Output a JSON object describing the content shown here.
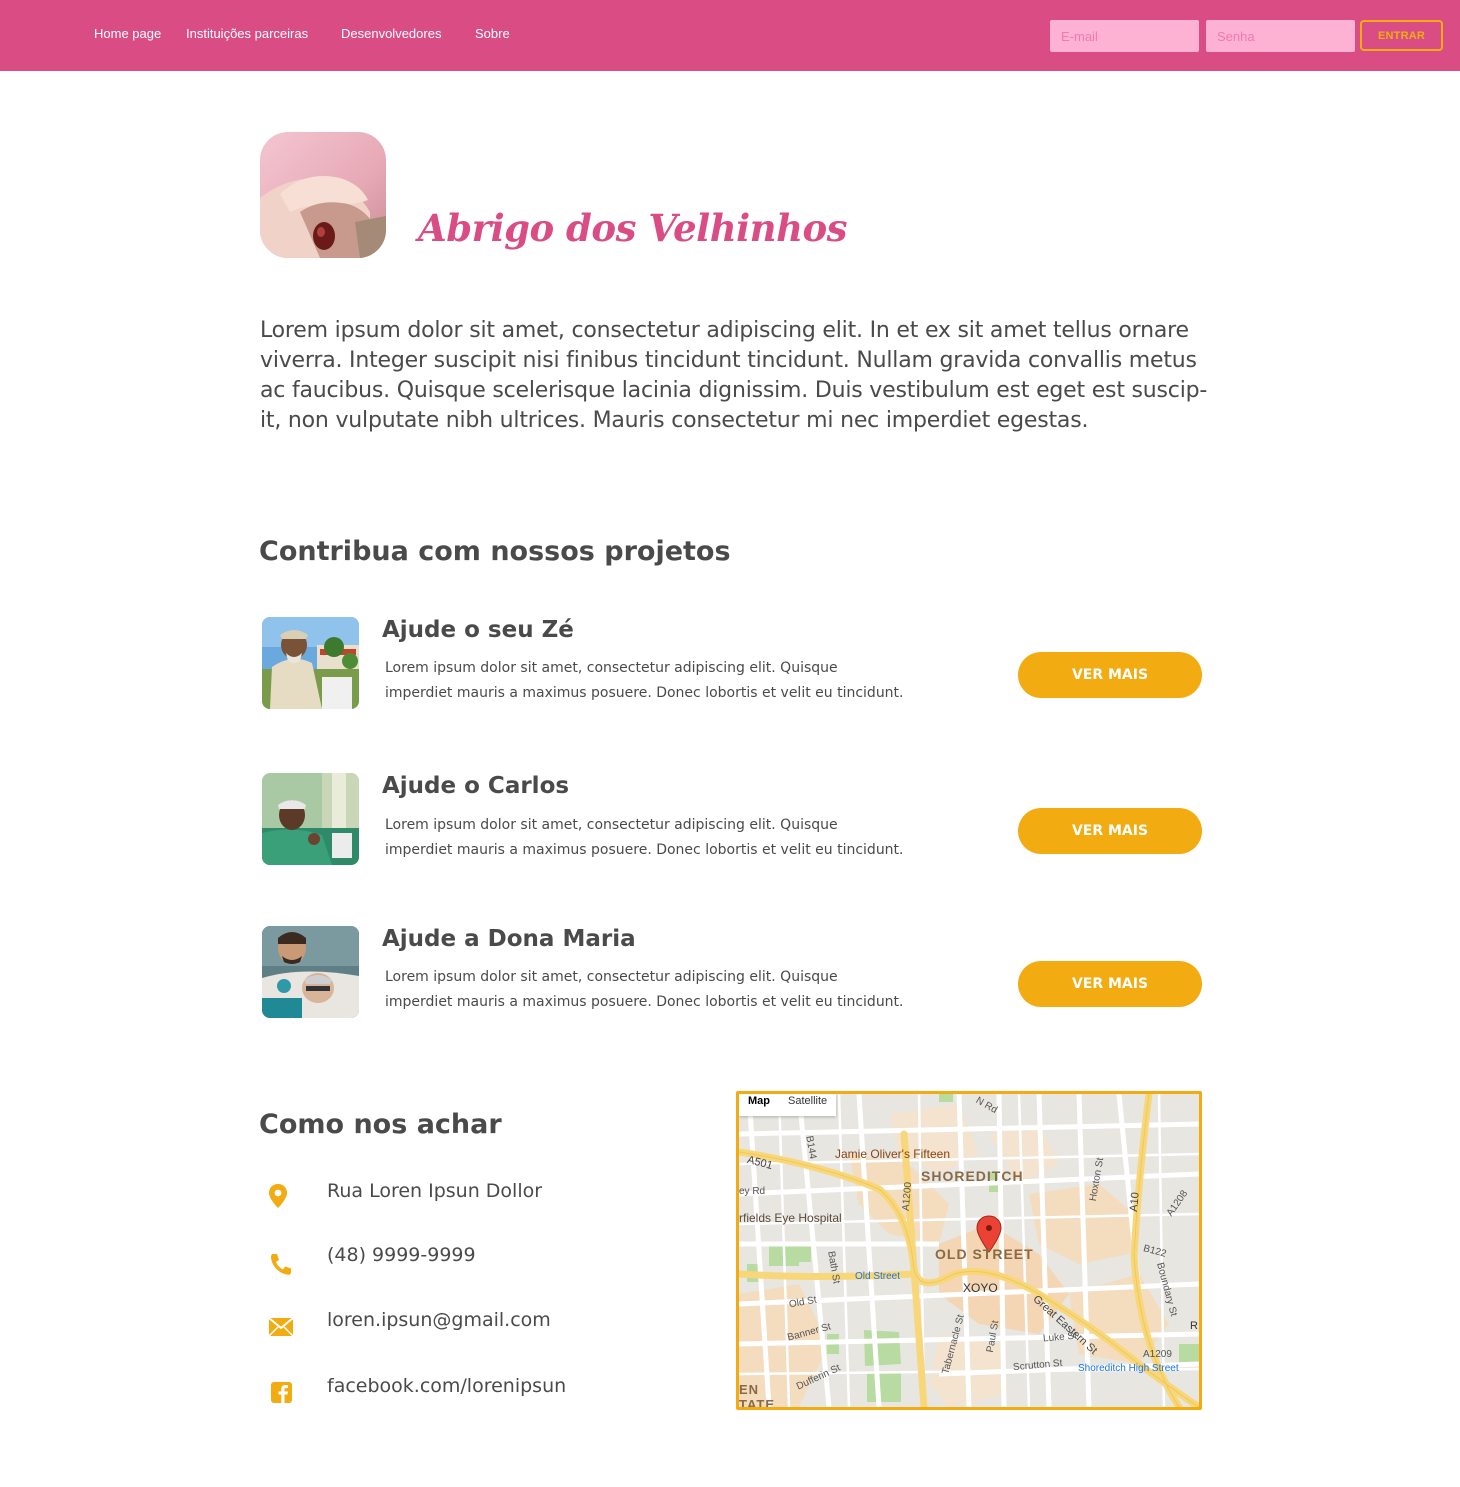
{
  "header": {
    "nav": [
      "Home page",
      "Instituições parceiras",
      "Desenvolvedores",
      "Sobre"
    ],
    "email_placeholder": "E-mail",
    "password_placeholder": "Senha",
    "login_label": "ENTRAR"
  },
  "institution": {
    "name": "Abrigo dos Velhinhos",
    "description": "Lorem ipsum dolor sit amet, consectetur adipiscing elit. In et ex sit amet tellus ornare viverra. Integer suscipit nisi finibus tincidunt tincidunt. Nullam gravida convallis metus ac faucibus. Quisque scelerisque lacinia dignissim. Duis vestibulum est eget est suscip-it, non vulputate nibh ultrices. Mauris consectetur mi nec imperdiet egestas."
  },
  "projects": {
    "title": "Contribua com nossos projetos",
    "items": [
      {
        "name": "Ajude o seu Zé",
        "description": "Lorem ipsum dolor sit amet, consectetur adipiscing elit. Quisque imperdiet mauris a maximus posuere. Donec lobortis et velit eu tincidunt.",
        "button": "VER MAIS"
      },
      {
        "name": "Ajude o Carlos",
        "description": "Lorem ipsum dolor sit amet, consectetur adipiscing elit. Quisque imperdiet mauris a maximus posuere. Donec lobortis et velit eu tincidunt.",
        "button": "VER MAIS"
      },
      {
        "name": "Ajude a Dona Maria",
        "description": "Lorem ipsum dolor sit amet, consectetur adipiscing elit. Quisque imperdiet mauris a maximus posuere. Donec lobortis et velit eu tincidunt.",
        "button": "VER MAIS"
      }
    ]
  },
  "contact": {
    "title": "Como nos achar",
    "address": "Rua Loren Ipsun Dollor",
    "phone": "(48) 9999-9999",
    "email": "loren.ipsun@gmail.com",
    "facebook": "facebook.com/lorenipsun"
  },
  "map": {
    "tabs": [
      "Map",
      "Satellite"
    ],
    "labels": {
      "district": "SHOREDITCH",
      "area": "OLD STREET",
      "poi1": "Jamie Oliver's Fifteen",
      "poi2": "rfields Eye Hospital",
      "poi3": "XOYO",
      "station1": "Old Street",
      "station2": "Shoreditch High Street",
      "road1": "A501",
      "road2": "B144",
      "road3": "A1200",
      "road4": "Hoxton St",
      "road5": "A10",
      "road6": "A1208",
      "road7": "B122",
      "road8": "Boundary St",
      "road9": "Bath St",
      "road10": "Old St",
      "road11": "Great Eastern St",
      "road12": "Banner St",
      "road13": "Tabernacle St",
      "road14": "Paul St",
      "road15": "Luke St",
      "road16": "Scrutton St",
      "road17": "Dufferin St",
      "road18": "A1209",
      "road19": "ey Rd",
      "road20": "N Rd",
      "road21": "EN",
      "road22": "TATE",
      "road23": "R"
    }
  },
  "colors": {
    "brand_pink": "#d94d84",
    "accent_yellow": "#f2ab10",
    "input_pink": "#fdb2d3",
    "text_gray": "#4a4a4a"
  }
}
